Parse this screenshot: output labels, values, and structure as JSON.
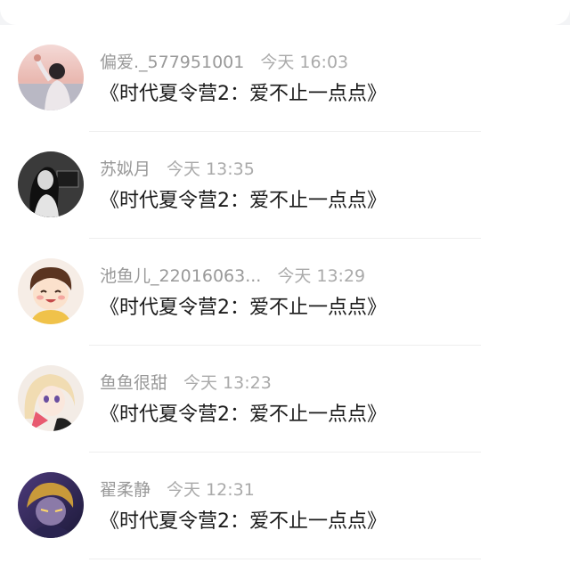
{
  "comments": [
    {
      "username": "偏爱._577951001",
      "time": "今天 16:03",
      "text": "《时代夏令营2：爱不止一点点》",
      "avatar_icon": "avatar-girl-sunset"
    },
    {
      "username": "苏姒月",
      "time": "今天 13:35",
      "text": "《时代夏令营2：爱不止一点点》",
      "avatar_icon": "avatar-girl-bw"
    },
    {
      "username": "池鱼儿_22016063...",
      "time": "今天 13:29",
      "text": "《时代夏令营2：爱不止一点点》",
      "avatar_icon": "avatar-cartoon-boy"
    },
    {
      "username": "鱼鱼很甜",
      "time": "今天 13:23",
      "text": "《时代夏令营2：爱不止一点点》",
      "avatar_icon": "avatar-anime-girl"
    },
    {
      "username": "翟柔静",
      "time": "今天 12:31",
      "text": "《时代夏令营2：爱不止一点点》",
      "avatar_icon": "avatar-anime-dark"
    }
  ],
  "colors": {
    "accent": "#4a90e2",
    "username": "#999999",
    "message": "#1a1a1a"
  }
}
